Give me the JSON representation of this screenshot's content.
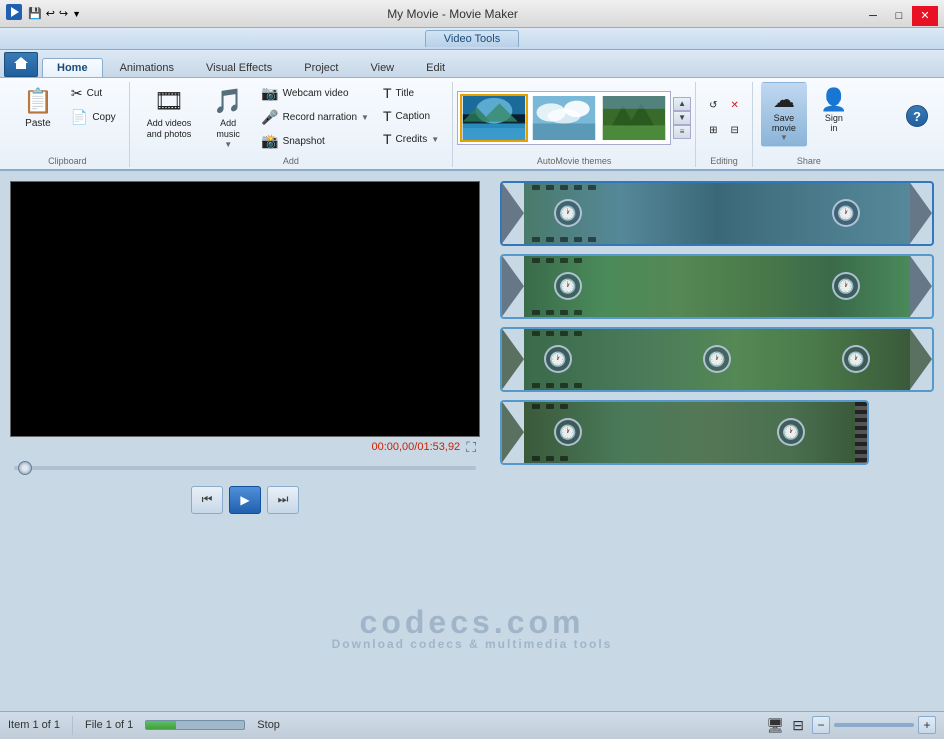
{
  "titlebar": {
    "app_title": "My Movie - Movie Maker",
    "video_tools_label": "Video Tools",
    "min_btn": "─",
    "max_btn": "□",
    "close_btn": "✕"
  },
  "tabs": {
    "home": "Home",
    "animations": "Animations",
    "visual_effects": "Visual Effects",
    "project": "Project",
    "view": "View",
    "edit": "Edit"
  },
  "ribbon": {
    "clipboard": {
      "label": "Clipboard",
      "paste": "Paste"
    },
    "add": {
      "label": "Add",
      "add_videos": "Add videos\nand photos",
      "add_music": "Add\nmusic",
      "webcam": "Webcam video",
      "record_narration": "Record narration",
      "snapshot": "Snapshot",
      "title": "Title",
      "caption": "Caption",
      "credits": "Credits"
    },
    "automovie": {
      "label": "AutoMovie themes"
    },
    "editing": {
      "label": "Editing"
    },
    "share": {
      "label": "Share",
      "save_movie": "Save\nmovie",
      "sign_in": "Sign\nin"
    }
  },
  "player": {
    "time_current": "00:00,00",
    "time_total": "01:53,92",
    "time_separator": "/"
  },
  "statusbar": {
    "item_count": "Item 1 of 1",
    "file_label": "File 1 of 1",
    "stop_label": "Stop"
  },
  "timeline": {
    "rows": [
      {
        "id": 1,
        "scene": "mountain",
        "clocks": [
          1,
          2
        ]
      },
      {
        "id": 2,
        "scene": "waterfall",
        "clocks": [
          1,
          2
        ]
      },
      {
        "id": 3,
        "scene": "waterfall",
        "clocks": [
          1,
          2,
          3
        ]
      },
      {
        "id": 4,
        "scene": "waterfall_partial",
        "clocks": [
          1,
          2
        ]
      }
    ]
  },
  "watermark": {
    "text": "codecs.com",
    "subtext": "Download codecs & multimedia tools"
  }
}
